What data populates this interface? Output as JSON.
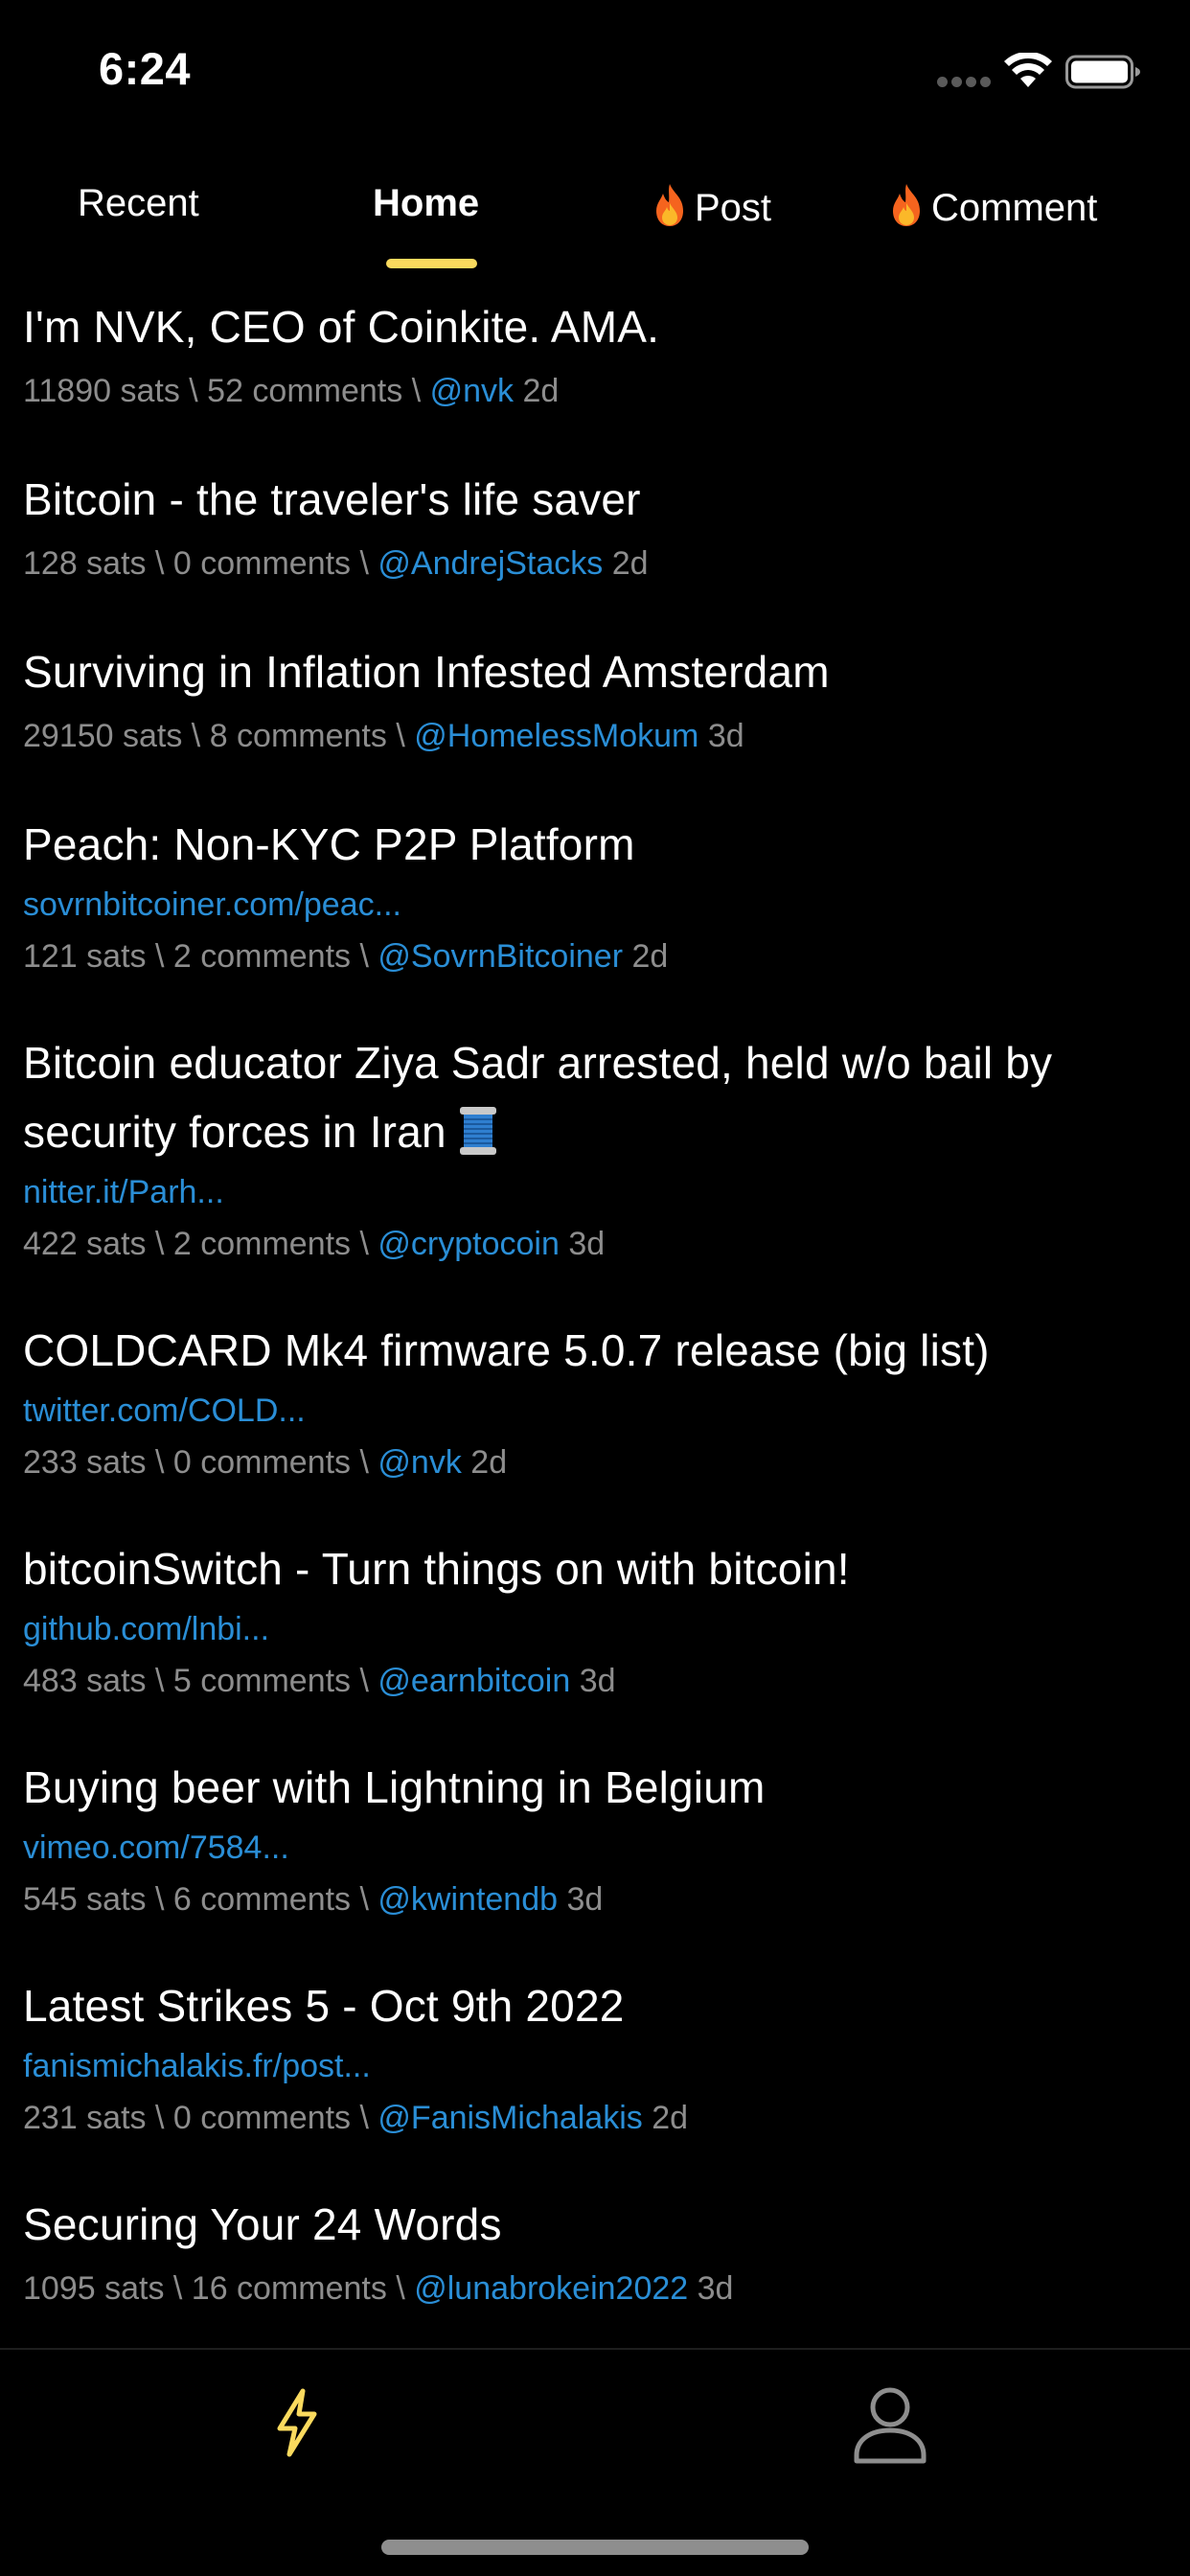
{
  "status_bar": {
    "time": "6:24"
  },
  "tabs": [
    {
      "label": "Recent"
    },
    {
      "label": "Home"
    },
    {
      "label": "Post"
    },
    {
      "label": "Comment"
    }
  ],
  "active_tab": "Home",
  "colors": {
    "accent": "#fada5e",
    "link": "#2a8ed6",
    "meta": "#8d8d8d",
    "background": "#000000"
  },
  "feed": [
    {
      "title": "I'm NVK, CEO of Coinkite. AMA.",
      "link": "",
      "sats": "11890 sats",
      "comments": "52 comments",
      "user": "@nvk",
      "age": "2d"
    },
    {
      "title": "Bitcoin - the traveler's life saver",
      "link": "",
      "sats": "128 sats",
      "comments": "0 comments",
      "user": "@AndrejStacks",
      "age": "2d"
    },
    {
      "title": "Surviving in Inflation Infested Amsterdam",
      "link": "",
      "sats": "29150 sats",
      "comments": "8 comments",
      "user": "@HomelessMokum",
      "age": "3d"
    },
    {
      "title": "Peach: Non-KYC P2P Platform",
      "link": "sovrnbitcoiner.com/peac...",
      "sats": "121 sats",
      "comments": "2 comments",
      "user": "@SovrnBitcoiner",
      "age": "2d"
    },
    {
      "title": "Bitcoin educator Ziya Sadr arrested, held w/o bail by security forces in Iran",
      "link": "nitter.it/Parh...",
      "sats": "422 sats",
      "comments": "2 comments",
      "user": "@cryptocoin",
      "age": "3d"
    },
    {
      "title": "COLDCARD Mk4 firmware 5.0.7 release (big list)",
      "link": "twitter.com/COLD...",
      "sats": "233 sats",
      "comments": "0 comments",
      "user": "@nvk",
      "age": "2d"
    },
    {
      "title": "bitcoinSwitch - Turn things on with bitcoin!",
      "link": "github.com/lnbi...",
      "sats": "483 sats",
      "comments": "5 comments",
      "user": "@earnbitcoin",
      "age": "3d"
    },
    {
      "title": "Buying beer with Lightning in Belgium",
      "link": "vimeo.com/7584...",
      "sats": "545 sats",
      "comments": "6 comments",
      "user": "@kwintendb",
      "age": "3d"
    },
    {
      "title": "Latest Strikes 5 - Oct 9th 2022",
      "link": "fanismichalakis.fr/post...",
      "sats": "231 sats",
      "comments": "0 comments",
      "user": "@FanisMichalakis",
      "age": "2d"
    },
    {
      "title": "Securing Your 24 Words",
      "link": "",
      "sats": "1095 sats",
      "comments": "16 comments",
      "user": "@lunabrokein2022",
      "age": "3d"
    }
  ],
  "bottom_nav": {
    "items": [
      "lightning-bolt-icon",
      "user-profile-icon"
    ]
  }
}
